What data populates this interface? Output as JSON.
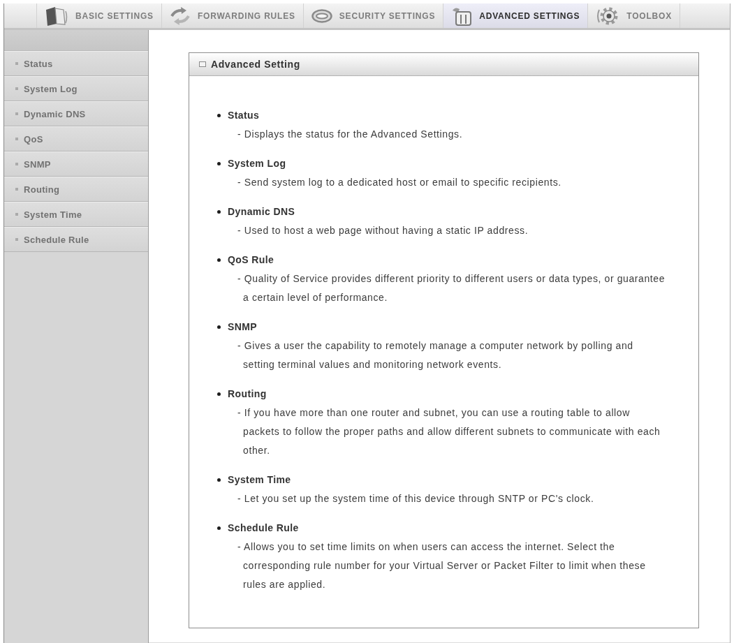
{
  "tabs": [
    {
      "label": "BASIC SETTINGS",
      "selected": false
    },
    {
      "label": "FORWARDING RULES",
      "selected": false
    },
    {
      "label": "SECURITY SETTINGS",
      "selected": false
    },
    {
      "label": "ADVANCED SETTINGS",
      "selected": true
    },
    {
      "label": "TOOLBOX",
      "selected": false
    }
  ],
  "sidebar": {
    "items": [
      {
        "label": "Status",
        "selected": false
      },
      {
        "label": "System Log",
        "selected": false
      },
      {
        "label": "Dynamic DNS",
        "selected": false
      },
      {
        "label": "QoS",
        "selected": false
      },
      {
        "label": "SNMP",
        "selected": false
      },
      {
        "label": "Routing",
        "selected": false
      },
      {
        "label": "System Time",
        "selected": false
      },
      {
        "label": "Schedule Rule",
        "selected": false
      }
    ]
  },
  "panel": {
    "title": "Advanced Setting",
    "items": [
      {
        "title": "Status",
        "description": "- Displays the status for the Advanced Settings."
      },
      {
        "title": "System Log",
        "description": "- Send system log to a dedicated host or email to specific recipients."
      },
      {
        "title": "Dynamic DNS",
        "description": "- Used to host a web page without having a static IP address."
      },
      {
        "title": "QoS Rule",
        "description": "- Quality of Service provides different priority to different users or data types, or guarantee a certain level of performance."
      },
      {
        "title": "SNMP",
        "description": "- Gives a user the capability to remotely manage a computer network by polling and setting terminal values and monitoring network events."
      },
      {
        "title": "Routing",
        "description": "- If you have more than one router and subnet, you can use a routing table to allow packets to follow the proper paths and allow different subnets to communicate with each other."
      },
      {
        "title": "System Time",
        "description": "- Let you set up the system time of this device through SNTP or PC's clock."
      },
      {
        "title": "Schedule Rule",
        "description": "- Allows you to set time limits on when users can access the internet. Select the corresponding rule number for your Virtual Server or Packet Filter to limit when these rules are applied."
      }
    ]
  }
}
